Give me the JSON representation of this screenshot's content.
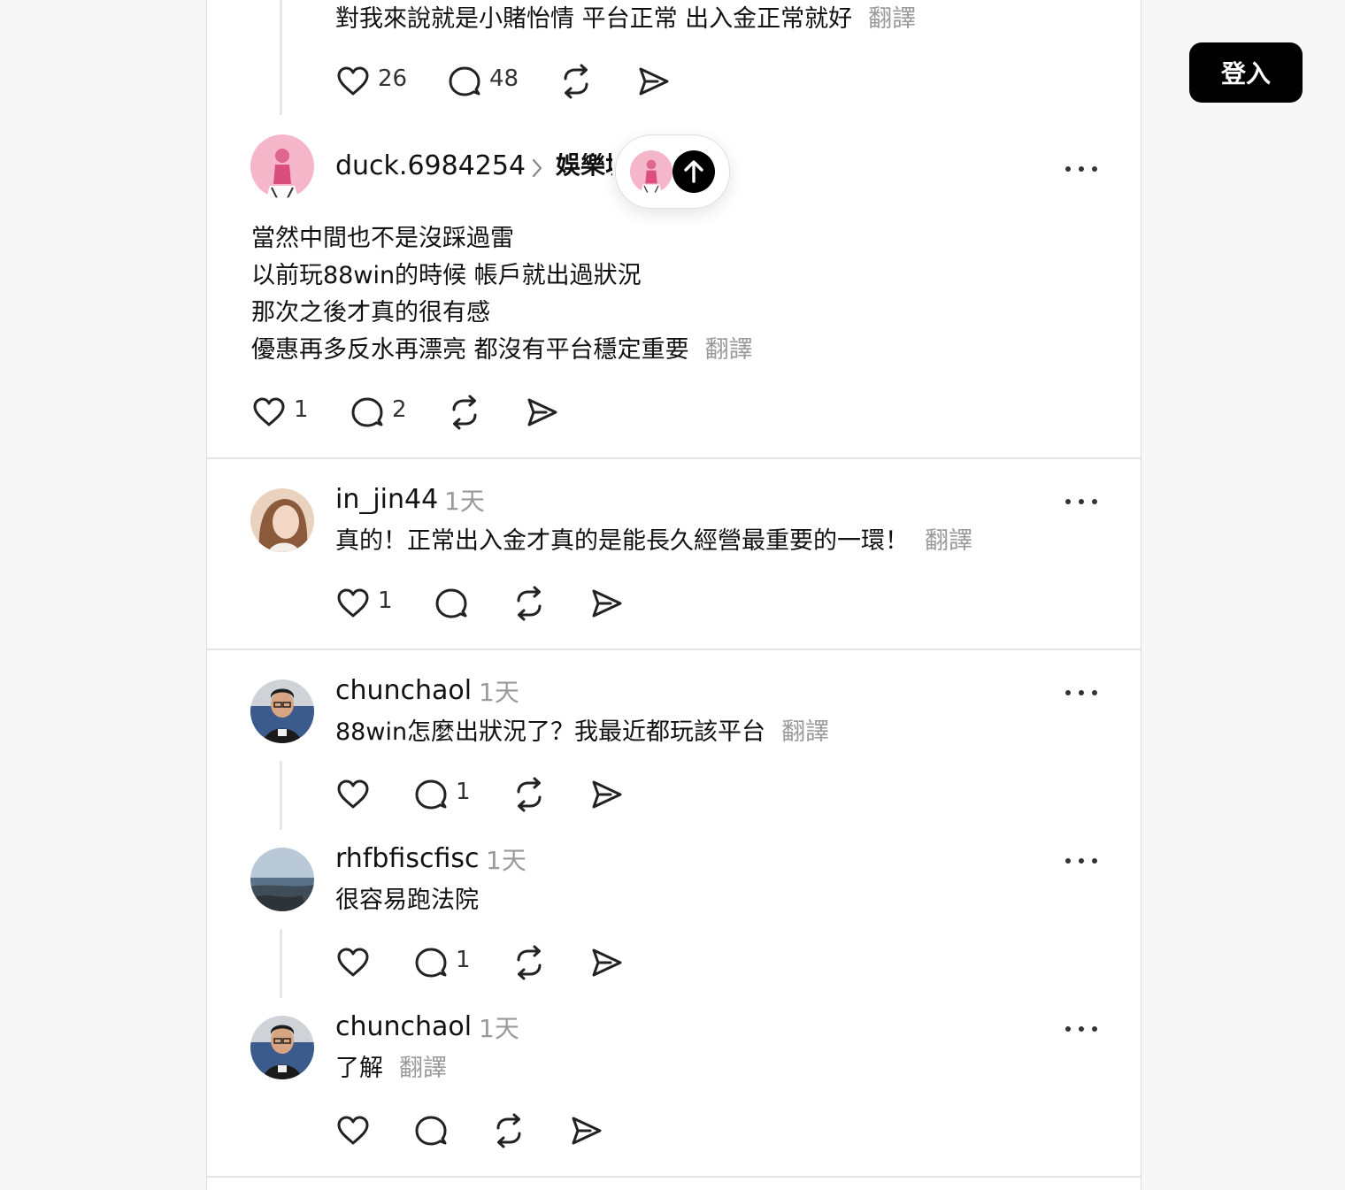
{
  "header": {
    "login_label": "登入"
  },
  "icons": {
    "like": "heart-icon",
    "reply": "comment-icon",
    "repost": "repost-icon",
    "share": "send-icon",
    "more": "more-horizontal-icon",
    "scroll_top": "arrow-up-icon"
  },
  "posts": [
    {
      "text_lines": [
        "對我來說就是小賭怡情 平台正常 出入金正常就好"
      ],
      "translate": "翻譯",
      "likes": "26",
      "replies": "48"
    },
    {
      "username": "duck.6984254",
      "community": "娛樂城",
      "text_lines": [
        "當然中間也不是沒踩過雷",
        "以前玩88win的時候 帳戶就出過狀況",
        "那次之後才真的很有感",
        "優惠再多反水再漂亮 都沒有平台穩定重要"
      ],
      "translate": "翻譯",
      "likes": "1",
      "replies": "2"
    },
    {
      "username": "in_jin44",
      "time": "1天",
      "text": "真的！正常出入金才真的是能長久經營最重要的一環！",
      "translate": "翻譯",
      "likes": "1",
      "replies": ""
    },
    {
      "username": "chunchaol",
      "time": "1天",
      "text": "88win怎麼出狀況了？我最近都玩該平台",
      "translate": "翻譯",
      "likes": "",
      "replies": "1"
    },
    {
      "username": "rhfbfiscfisc",
      "time": "1天",
      "text": "很容易跑法院",
      "translate": "",
      "likes": "",
      "replies": "1"
    },
    {
      "username": "chunchaol",
      "time": "1天",
      "text": "了解",
      "translate": "翻譯",
      "likes": "",
      "replies": ""
    }
  ]
}
